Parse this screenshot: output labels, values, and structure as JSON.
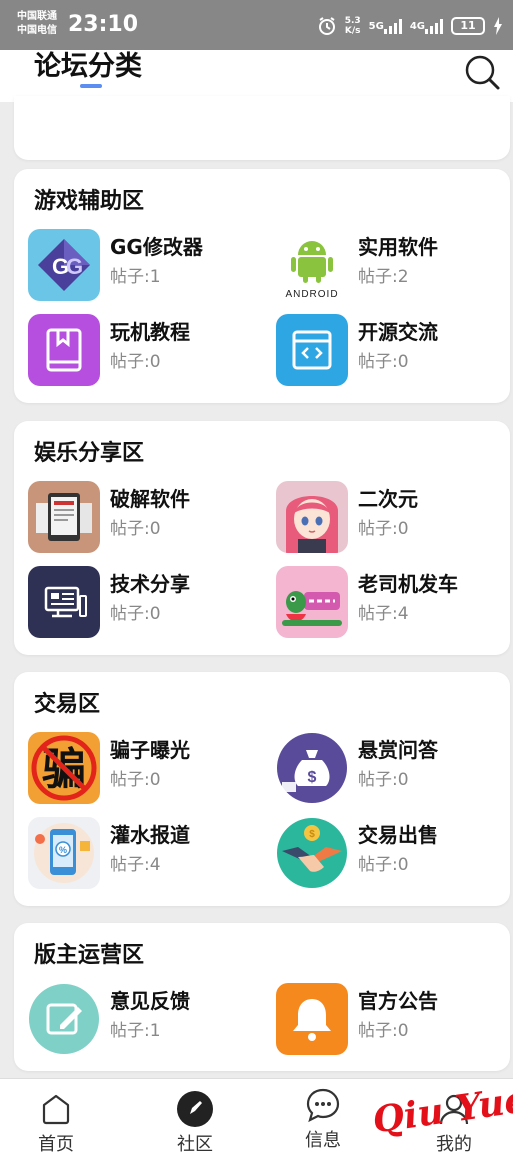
{
  "status_bar": {
    "carrier_1": "中国联通",
    "carrier_2": "中国电信",
    "time": "23:10",
    "speed_value": "5.3",
    "speed_unit": "K/s",
    "net_1": "5G",
    "net_2": "4G",
    "battery": "11"
  },
  "header": {
    "title": "论坛分类",
    "accent_color": "#5b8ef0"
  },
  "sections": [
    {
      "title": "游戏辅助区",
      "items": [
        {
          "name": "GG修改器",
          "count": "帖子:1",
          "icon": "gg-modifier-icon"
        },
        {
          "name": "实用软件",
          "count": "帖子:2",
          "icon": "android-icon",
          "icon_text": "ANDROID"
        },
        {
          "name": "玩机教程",
          "count": "帖子:0",
          "icon": "book-icon"
        },
        {
          "name": "开源交流",
          "count": "帖子:0",
          "icon": "code-window-icon"
        }
      ]
    },
    {
      "title": "娱乐分享区",
      "items": [
        {
          "name": "破解软件",
          "count": "帖子:0",
          "icon": "news-tablet-icon"
        },
        {
          "name": "二次元",
          "count": "帖子:0",
          "icon": "anime-girl-icon"
        },
        {
          "name": "技术分享",
          "count": "帖子:0",
          "icon": "computer-icon"
        },
        {
          "name": "老司机发车",
          "count": "帖子:4",
          "icon": "cartoon-icon"
        }
      ]
    },
    {
      "title": "交易区",
      "items": [
        {
          "name": "骗子曝光",
          "count": "帖子:0",
          "icon": "scam-ban-icon",
          "icon_text": "骗"
        },
        {
          "name": "悬赏问答",
          "count": "帖子:0",
          "icon": "money-bag-icon"
        },
        {
          "name": "灌水报道",
          "count": "帖子:4",
          "icon": "phone-discount-icon"
        },
        {
          "name": "交易出售",
          "count": "帖子:0",
          "icon": "handshake-icon"
        }
      ]
    },
    {
      "title": "版主运营区",
      "items": [
        {
          "name": "意见反馈",
          "count": "帖子:1",
          "icon": "edit-icon"
        },
        {
          "name": "官方公告",
          "count": "帖子:0",
          "icon": "bell-icon"
        }
      ]
    }
  ],
  "bottom_nav": [
    {
      "label": "首页",
      "icon": "home-icon"
    },
    {
      "label": "社区",
      "icon": "community-icon"
    },
    {
      "label": "信息",
      "icon": "message-icon"
    },
    {
      "label": "我的",
      "icon": "profile-icon"
    }
  ],
  "watermark": "Qiu Yue"
}
